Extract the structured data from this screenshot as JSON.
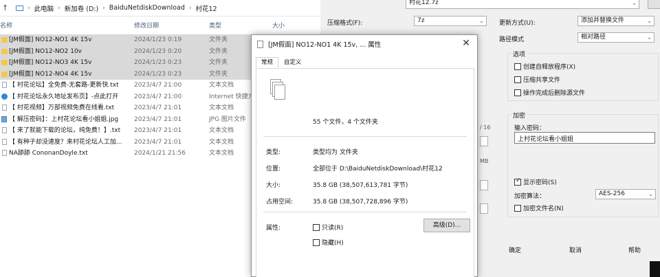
{
  "explorer": {
    "breadcrumb": [
      "此电脑",
      "新加卷 (D:)",
      "BaiduNetdiskDownload",
      "村花12"
    ],
    "columns": {
      "name": "名称",
      "date": "修改日期",
      "type": "类型",
      "size": "大小"
    },
    "files": [
      {
        "name": "[JM假面] NO12-NO1 4K 15v",
        "date": "2024/1/23 0:19",
        "type": "文件夹",
        "icon": "folder-icon",
        "selected": true
      },
      {
        "name": "[JM假面] NO12-NO2 10v",
        "date": "2024/1/23 0:20",
        "type": "文件夹",
        "icon": "folder-icon",
        "selected": true
      },
      {
        "name": "[JM假面] NO12-NO3 4K 15v",
        "date": "2024/1/23 0:23",
        "type": "文件夹",
        "icon": "folder-icon",
        "selected": true
      },
      {
        "name": "[JM假面] NO12-NO4 4K 15v",
        "date": "2024/1/23 0:23",
        "type": "文件夹",
        "icon": "folder-icon",
        "selected": true
      },
      {
        "name": "【 村花论坛】全免费-无套路-更新快.txt",
        "date": "2023/4/7 21:00",
        "type": "文本文档",
        "icon": "text-file-icon",
        "selected": false
      },
      {
        "name": "【 村花论坛永久地址发布页】-点此打开",
        "date": "2023/4/7 21:00",
        "type": "Internet 快捷方",
        "icon": "internet-shortcut-icon",
        "selected": false
      },
      {
        "name": "【 村花视频】万部视频免费在线看.txt",
        "date": "2023/4/7 21:01",
        "type": "文本文档",
        "icon": "text-file-icon",
        "selected": false
      },
      {
        "name": "【 解压密码】：上村花论坛看小姐姐.jpg",
        "date": "2023/4/7 21:01",
        "type": "JPG 图片文件",
        "icon": "image-file-icon",
        "selected": false
      },
      {
        "name": "【 来了就能下载的论坛，纯免费！】.txt",
        "date": "2023/4/7 21:01",
        "type": "文本文档",
        "icon": "text-file-icon",
        "selected": false
      },
      {
        "name": "【 有种子却没速度？来村花论坛人工加...",
        "date": "2023/4/7 21:01",
        "type": "文本文档",
        "icon": "text-file-icon",
        "selected": false
      },
      {
        "name": "NA舔舔 CononanDoyle.txt",
        "date": "2024/1/21 21:56",
        "type": "文本文档",
        "icon": "text-file-icon",
        "selected": false
      }
    ]
  },
  "archive": {
    "archive_name": "村花12.7z",
    "format_label": "压缩格式(F):",
    "format_value": "7z",
    "update_label": "更新方式(U):",
    "update_value": "添加并替换文件",
    "path_label": "路径模式",
    "path_value": "相对路径",
    "options_label": "选项",
    "opt_sfx": "创建自释放程序(X)",
    "opt_shared": "压缩共享文件",
    "opt_delete": "操作完成后删除源文件",
    "encrypt_label": "加密",
    "password_label": "输入密码：",
    "password_value": "上村花论坛看小姐姐",
    "show_password": "显示密码(S)",
    "method_label": "加密算法：",
    "method_value": "AES-256",
    "encrypt_names": "加密文件名(N)",
    "ok": "确定",
    "cancel": "取消",
    "help": "帮助",
    "frag_1": "/ 16",
    "frag_2": "MB"
  },
  "props": {
    "title": "[JM假面] NO12-NO1 4K 15v, ... 属性",
    "tab_general": "常规",
    "tab_custom": "自定义",
    "summary": "55 个文件，4 个文件夹",
    "type_label": "类型:",
    "type_value": "类型均为 文件夹",
    "location_label": "位置:",
    "location_value": "全部位于 D:\\BaiduNetdiskDownload\\村花12",
    "size_label": "大小:",
    "size_value": "35.8 GB (38,507,613,781 字节)",
    "disk_label": "占用空间:",
    "disk_value": "35.8 GB (38,507,728,896 字节)",
    "attr_label": "属性:",
    "readonly": "只读(R)",
    "hidden": "隐藏(H)",
    "advanced": "高级(D)..."
  }
}
